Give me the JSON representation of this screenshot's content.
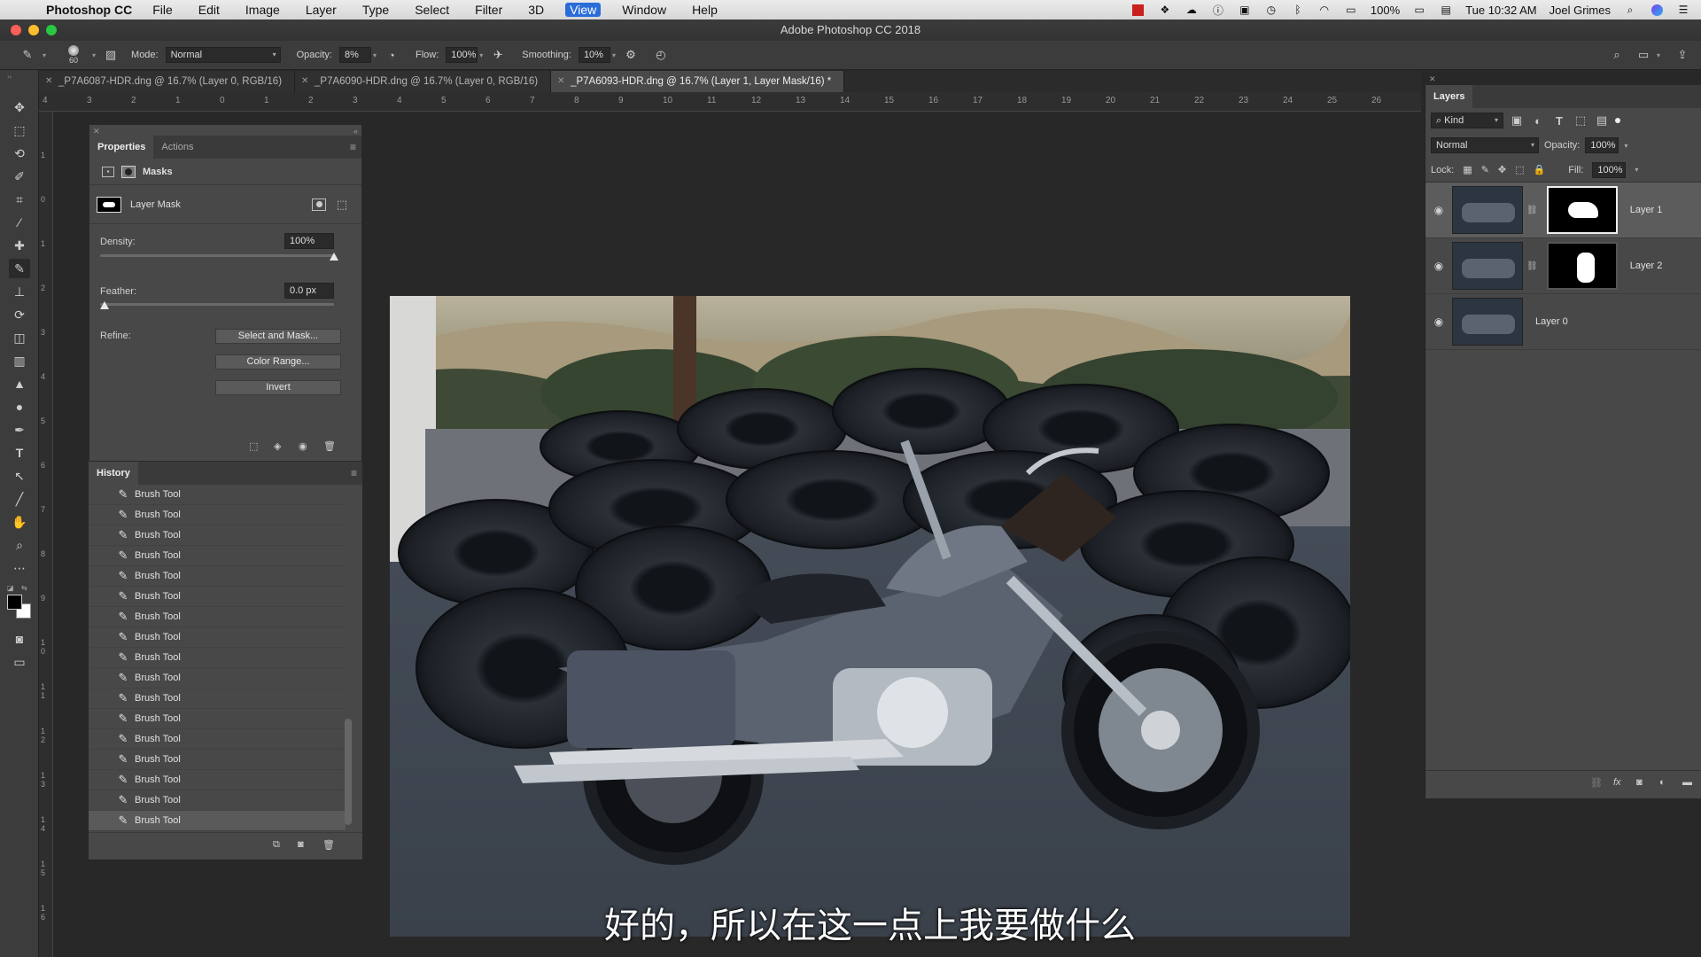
{
  "menubar": {
    "app_name": "Photoshop CC",
    "items": [
      "File",
      "Edit",
      "Image",
      "Layer",
      "Type",
      "Select",
      "Filter",
      "3D",
      "View",
      "Window",
      "Help"
    ],
    "active_item": "View",
    "battery": "100%",
    "clock": "Tue 10:32 AM",
    "user": "Joel Grimes"
  },
  "window": {
    "title": "Adobe Photoshop CC 2018"
  },
  "options": {
    "brush_size": "60",
    "mode_label": "Mode:",
    "mode_value": "Normal",
    "opacity_label": "Opacity:",
    "opacity_value": "8%",
    "flow_label": "Flow:",
    "flow_value": "100%",
    "smoothing_label": "Smoothing:",
    "smoothing_value": "10%"
  },
  "tabs": [
    {
      "label": "_P7A6087-HDR.dng @ 16.7% (Layer 0, RGB/16)"
    },
    {
      "label": "_P7A6090-HDR.dng @ 16.7% (Layer 0, RGB/16)"
    },
    {
      "label": "_P7A6093-HDR.dng @ 16.7% (Layer 1, Layer Mask/16) *"
    }
  ],
  "ruler": {
    "h_ticks": [
      "4",
      "3",
      "2",
      "1",
      "0",
      "1",
      "2",
      "3",
      "4",
      "5",
      "6",
      "7",
      "8",
      "9",
      "10",
      "11",
      "12",
      "13",
      "14",
      "15",
      "16",
      "17",
      "18",
      "19",
      "20",
      "21",
      "22",
      "23",
      "24",
      "25",
      "26"
    ],
    "v_ticks": [
      "1",
      "0",
      "1",
      "2",
      "3",
      "4",
      "5",
      "6",
      "7",
      "8",
      "9",
      "1 0",
      "1 1",
      "1 2",
      "1 3",
      "1 4",
      "1 5",
      "1 6"
    ]
  },
  "properties": {
    "tabs": [
      "Properties",
      "Actions"
    ],
    "masks_label": "Masks",
    "mask_type": "Layer Mask",
    "density_label": "Density:",
    "density_value": "100%",
    "density_level": 100,
    "feather_label": "Feather:",
    "feather_value": "0.0 px",
    "feather_level": 0,
    "refine_label": "Refine:",
    "select_mask_button": "Select and Mask...",
    "color_range_button": "Color Range...",
    "invert_button": "Invert"
  },
  "history": {
    "title": "History",
    "items": [
      "Brush Tool",
      "Brush Tool",
      "Brush Tool",
      "Brush Tool",
      "Brush Tool",
      "Brush Tool",
      "Brush Tool",
      "Brush Tool",
      "Brush Tool",
      "Brush Tool",
      "Brush Tool",
      "Brush Tool",
      "Brush Tool",
      "Brush Tool",
      "Brush Tool",
      "Brush Tool",
      "Brush Tool"
    ]
  },
  "layers": {
    "title": "Layers",
    "kind_label": "Kind",
    "blend_mode": "Normal",
    "opacity_label": "Opacity:",
    "opacity_value": "100%",
    "lock_label": "Lock:",
    "fill_label": "Fill:",
    "fill_value": "100%",
    "items": [
      {
        "name": "Layer 1",
        "has_mask": true
      },
      {
        "name": "Layer 2",
        "has_mask": true
      },
      {
        "name": "Layer 0",
        "has_mask": false
      }
    ]
  },
  "subtitle": "好的，所以在这一点上我要做什么"
}
